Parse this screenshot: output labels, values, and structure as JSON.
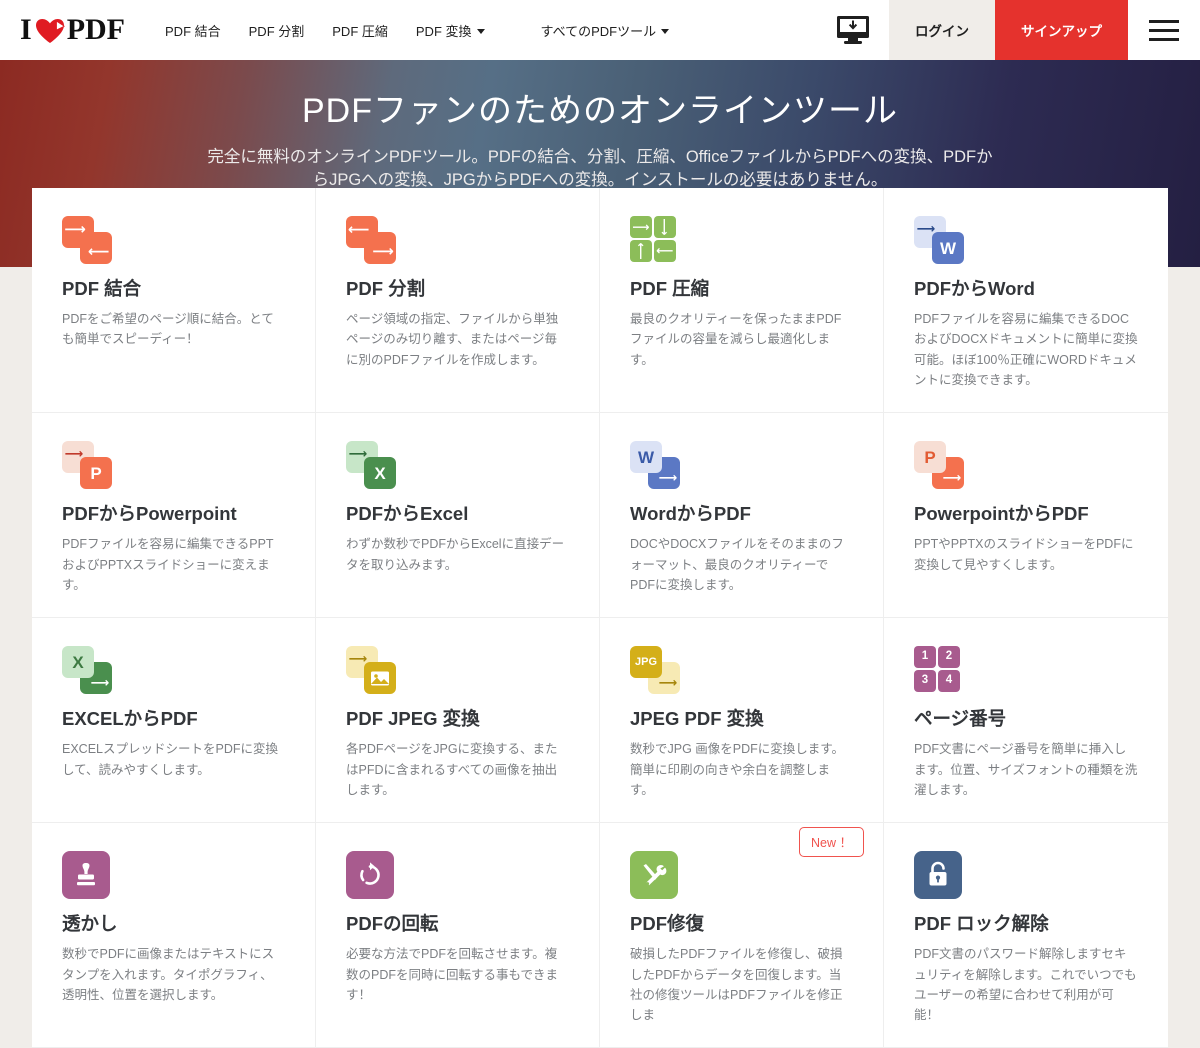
{
  "header": {
    "logo_text_left": "I",
    "logo_text_right": "PDF",
    "logo_heart_icon": "heart-icon",
    "nav": [
      {
        "label": "PDF 結合",
        "has_caret": false
      },
      {
        "label": "PDF 分割",
        "has_caret": false
      },
      {
        "label": "PDF 圧縮",
        "has_caret": false
      },
      {
        "label": "PDF 変換",
        "has_caret": true
      },
      {
        "label": "すべてのPDFツール",
        "has_caret": true
      }
    ],
    "desktop_icon": "desktop-download-icon",
    "login_label": "ログイン",
    "signup_label": "サインアップ",
    "menu_icon": "hamburger-menu-icon",
    "signup_color": "#e5322d",
    "login_bg_color": "#f0ede9"
  },
  "hero": {
    "title": "PDFファンのためのオンラインツール",
    "subtitle": "完全に無料のオンラインPDFツール。PDFの結合、分割、圧縮、OfficeファイルからPDFへの変換、PDFからJPGへの変換、JPGからPDFへの変換。インストールの必要はありません。"
  },
  "tools": [
    {
      "title": "PDF 結合",
      "desc": "PDFをご希望のページ順に結合。とても簡単でスピーディー！",
      "icon": "merge-icon",
      "colors": {
        "primary": "#f4714e",
        "secondary": "#f4714e"
      }
    },
    {
      "title": "PDF 分割",
      "desc": "ページ領域の指定、ファイルから単独ページのみ切り離す、またはページ毎に別のPDFファイルを作成します。",
      "icon": "split-icon",
      "colors": {
        "primary": "#f4714e",
        "secondary": "#f4714e"
      }
    },
    {
      "title": "PDF 圧縮",
      "desc": "最良のクオリティーを保ったままPDFファイルの容量を減らし最適化します。",
      "icon": "compress-icon",
      "colors": {
        "primary": "#8cbd59",
        "secondary": "#8cbd59"
      }
    },
    {
      "title": "PDFからWord",
      "desc": "PDFファイルを容易に編集できるDOCおよびDOCXドキュメントに簡単に変換可能。ほぼ100％正確にWORDドキュメントに変換できます。",
      "icon": "pdf-to-word-icon",
      "letter": "W",
      "colors": {
        "primary": "#5b78c4",
        "secondary": "#dbe2f5"
      }
    },
    {
      "title": "PDFからPowerpoint",
      "desc": "PDFファイルを容易に編集できるPPTおよびPPTXスライドショーに変えます。",
      "icon": "pdf-to-powerpoint-icon",
      "letter": "P",
      "colors": {
        "primary": "#f4714e",
        "secondary": "#f7ded4"
      }
    },
    {
      "title": "PDFからExcel",
      "desc": "わずか数秒でPDFからExcelに直接データを取り込みます。",
      "icon": "pdf-to-excel-icon",
      "letter": "X",
      "colors": {
        "primary": "#4a8f4e",
        "secondary": "#c7e6c8"
      }
    },
    {
      "title": "WordからPDF",
      "desc": "DOCやDOCXファイルをそのままのフォーマット、最良のクオリティーでPDFに変換します。",
      "icon": "word-to-pdf-icon",
      "letter": "W",
      "colors": {
        "primary": "#5b78c4",
        "secondary": "#dbe2f5"
      }
    },
    {
      "title": "PowerpointからPDF",
      "desc": "PPTやPPTXのスライドショーをPDFに変換して見やすくします。",
      "icon": "powerpoint-to-pdf-icon",
      "letter": "P",
      "colors": {
        "primary": "#f4714e",
        "secondary": "#f7ded4"
      }
    },
    {
      "title": "EXCELからPDF",
      "desc": "EXCELスプレッドシートをPDFに変換して、読みやすくします。",
      "icon": "excel-to-pdf-icon",
      "letter": "X",
      "colors": {
        "primary": "#4a8f4e",
        "secondary": "#c7e6c8"
      }
    },
    {
      "title": "PDF JPEG 変換",
      "desc": "各PDFページをJPGに変換する、またはPFDに含まれるすべての画像を抽出します。",
      "icon": "pdf-to-jpeg-icon",
      "colors": {
        "primary": "#d4af19",
        "secondary": "#f7eab4"
      }
    },
    {
      "title": "JPEG PDF 変換",
      "desc": "数秒でJPG 画像をPDFに変換します。簡単に印刷の向きや余白を調整します。",
      "icon": "jpeg-to-pdf-icon",
      "letter": "JPG",
      "colors": {
        "primary": "#d4af19",
        "secondary": "#f7eab4"
      }
    },
    {
      "title": "ページ番号",
      "desc": "PDF文書にページ番号を簡単に挿入します。位置、サイズフォントの種類を洗濯します。",
      "icon": "page-numbers-icon",
      "numbers": [
        "1",
        "2",
        "3",
        "4"
      ],
      "colors": {
        "primary": "#a85b8e",
        "secondary": "#a85b8e"
      }
    },
    {
      "title": "透かし",
      "desc": "数秒でPDFに画像またはテキストにスタンプを入れます。タイポグラフィ、透明性、位置を選択します。",
      "icon": "watermark-stamp-icon",
      "colors": {
        "primary": "#a85b8e",
        "secondary": "#a85b8e"
      }
    },
    {
      "title": "PDFの回転",
      "desc": "必要な方法でPDFを回転させます。複数のPDFを同時に回転する事もできます！",
      "icon": "rotate-icon",
      "colors": {
        "primary": "#a85b8e",
        "secondary": "#a85b8e"
      }
    },
    {
      "title": "PDF修復",
      "desc": "破損したPDFファイルを修復し、破損したPDFからデータを回復します。当社の修復ツールはPDFファイルを修正しま",
      "icon": "repair-tools-icon",
      "badge": "New ！",
      "colors": {
        "primary": "#8cbd59",
        "secondary": "#8cbd59"
      }
    },
    {
      "title": "PDF ロック解除",
      "desc": "PDF文書のパスワード解除しますセキュリティを解除します。これでいつでもユーザーの希望に合わせて利用が可能！",
      "icon": "unlock-padlock-icon",
      "colors": {
        "primary": "#46638a",
        "secondary": "#46638a"
      }
    }
  ]
}
